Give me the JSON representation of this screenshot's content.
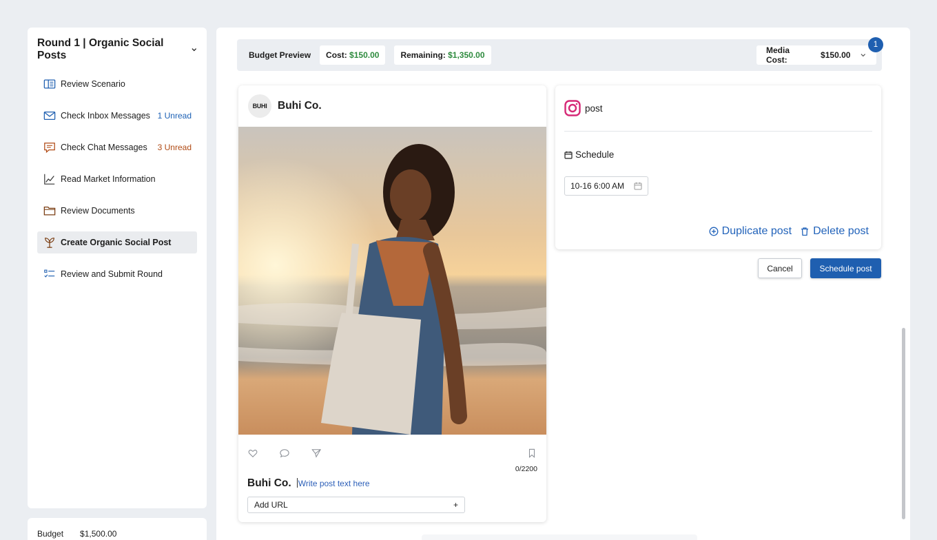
{
  "sidebar": {
    "title": "Round 1 | Organic Social Posts",
    "items": [
      {
        "label": "Review Scenario",
        "icon": "book-icon",
        "badge": ""
      },
      {
        "label": "Check Inbox Messages",
        "icon": "mail-icon",
        "badge": "1 Unread"
      },
      {
        "label": "Check Chat Messages",
        "icon": "chat-icon",
        "badge": "3 Unread"
      },
      {
        "label": "Read Market Information",
        "icon": "line-chart-icon",
        "badge": ""
      },
      {
        "label": "Review Documents",
        "icon": "folder-icon",
        "badge": ""
      },
      {
        "label": "Create Organic Social Post",
        "icon": "plant-icon",
        "badge": ""
      },
      {
        "label": "Review and Submit Round",
        "icon": "checklist-icon",
        "badge": ""
      }
    ]
  },
  "budget": {
    "label": "Budget",
    "value": "$1,500.00"
  },
  "budget_bar": {
    "title": "Budget Preview",
    "cost_label": "Cost:",
    "cost_value": "$150.00",
    "remaining_label": "Remaining:",
    "remaining_value": "$1,350.00",
    "media_cost_label": "Media Cost:",
    "media_cost_value": "$150.00",
    "notification_count": "1"
  },
  "post": {
    "avatar_text": "BUHI",
    "brand": "Buhi Co.",
    "char_counter": "0/2200",
    "caption_placeholder": "Write post text here",
    "add_url_label": "Add URL",
    "add_url_plus": "+"
  },
  "settings": {
    "platform_label": "post",
    "schedule_label": "Schedule",
    "date_value": "10-16 6:00 AM",
    "duplicate_label": "Duplicate post",
    "delete_label": "Delete post"
  },
  "buttons": {
    "cancel": "Cancel",
    "schedule": "Schedule post"
  },
  "colors": {
    "accent": "#1f5fb0",
    "green": "#2e8b3e",
    "instagram": "#d62976"
  }
}
